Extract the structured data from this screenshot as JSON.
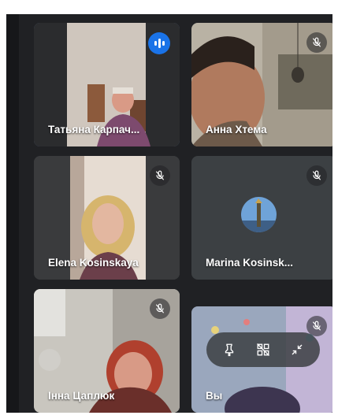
{
  "participants": [
    {
      "name": "Татьяна Карпач...",
      "speaking": true
    },
    {
      "name": "Анна Хтема",
      "muted": true
    },
    {
      "name": "Elena Kosinskaya",
      "muted": true
    },
    {
      "name": "Marina Kosinsk...",
      "muted": true
    },
    {
      "name": "Інна Цаплюк",
      "muted": true
    },
    {
      "name": "Вы",
      "muted": true
    }
  ],
  "self_tile_controls": [
    "pin-icon",
    "hide-tile-icon",
    "minimize-icon"
  ],
  "colors": {
    "stage": "#202124",
    "tile": "#3c4043",
    "active_outline": "#8ab4f8",
    "speaking": "#1a73e8"
  }
}
